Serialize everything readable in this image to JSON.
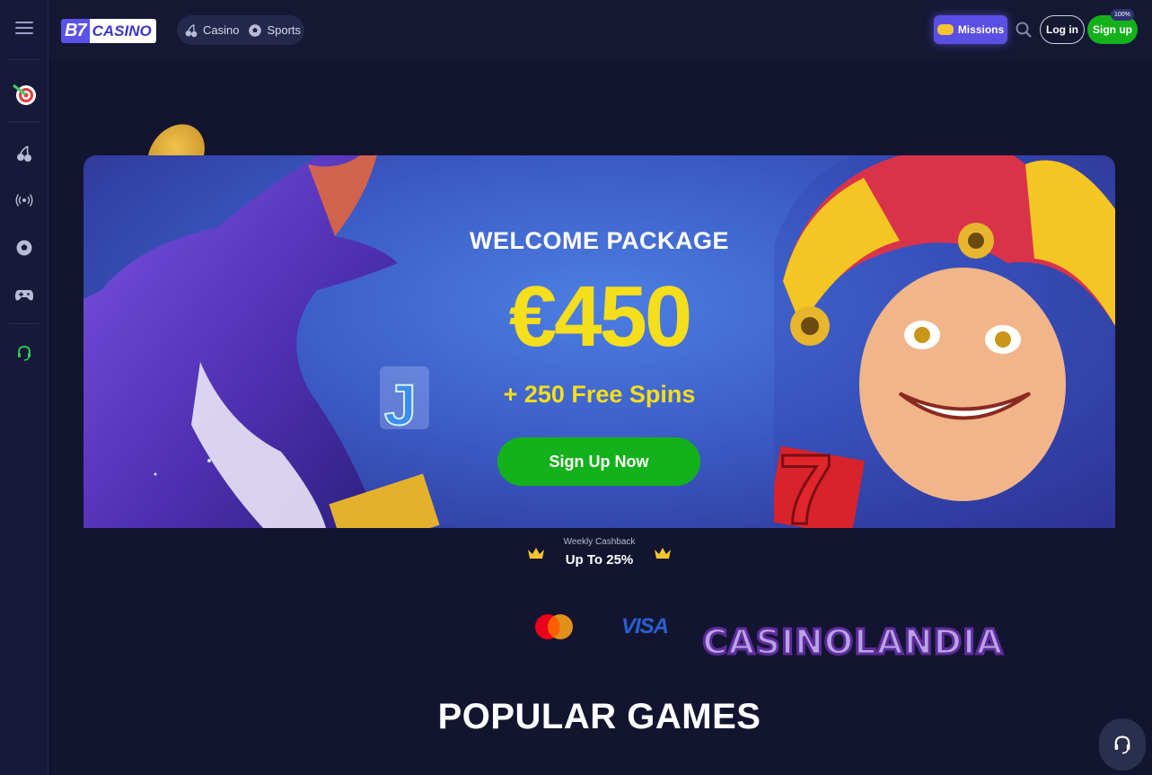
{
  "header": {
    "logo_left": "B7",
    "logo_right": "CASINO",
    "nav": [
      {
        "label": "Casino",
        "icon": "cherry-icon"
      },
      {
        "label": "Sports",
        "icon": "soccer-ball-icon"
      }
    ],
    "missions_label": "Missions",
    "login_label": "Log in",
    "signup_label": "Sign up",
    "signup_badge": "100%"
  },
  "sidebar": {
    "items": [
      {
        "icon": "dart-target-icon"
      },
      {
        "icon": "cherry-icon"
      },
      {
        "icon": "live-broadcast-icon"
      },
      {
        "icon": "soccer-ball-icon"
      },
      {
        "icon": "gamepad-icon"
      },
      {
        "icon": "headset-icon"
      }
    ]
  },
  "banner": {
    "title": "WELCOME PACKAGE",
    "amount": "€450",
    "subtitle": "+ 250 Free Spins",
    "cta_label": "Sign Up Now"
  },
  "cashback": {
    "label": "Weekly Cashback",
    "value": "Up To 25%"
  },
  "payments": {
    "visa": "VISA",
    "partner": "CASINOLANDIA"
  },
  "section_title": "POPULAR GAMES",
  "colors": {
    "accent_green": "#14b11c",
    "accent_purple": "#5a4fe3",
    "highlight_yellow": "#f5de1c",
    "background": "#131530"
  }
}
